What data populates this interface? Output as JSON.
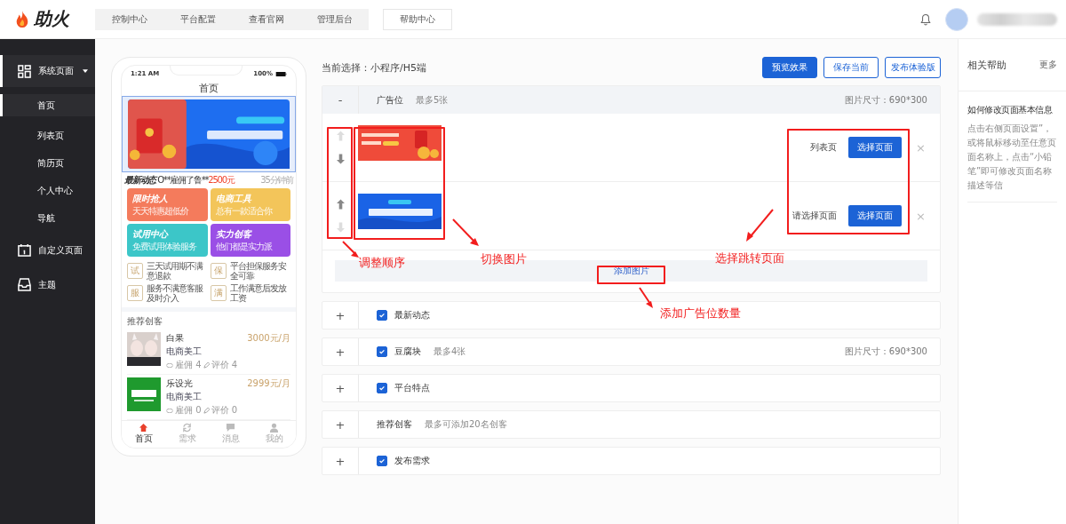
{
  "logo": {
    "text": "助火"
  },
  "top_nav": [
    {
      "label": "控制中心",
      "selected": false
    },
    {
      "label": "平台配置",
      "selected": false
    },
    {
      "label": "查看官网",
      "selected": false
    },
    {
      "label": "管理后台",
      "selected": false
    }
  ],
  "help_link": "帮助中心",
  "sidebar": {
    "items": [
      {
        "label": "系统页面",
        "expanded": true,
        "children": [
          {
            "label": "首页",
            "selected": true
          },
          {
            "label": "列表页",
            "selected": false
          },
          {
            "label": "简历页",
            "selected": false
          },
          {
            "label": "个人中心",
            "selected": false
          },
          {
            "label": "导航",
            "selected": false
          }
        ]
      },
      {
        "label": "自定义页面"
      },
      {
        "label": "主题"
      }
    ]
  },
  "phone": {
    "time": "1:21 AM",
    "battery": "100%",
    "title": "首页",
    "news": {
      "label": "最新动态",
      "text": "O**雇佣了鲁**",
      "amount": "2500元",
      "time": "35分钟前"
    },
    "tiles": [
      {
        "title": "限时抢人",
        "subtitle": "天天特惠超低价",
        "color": "#f47b5c"
      },
      {
        "title": "电商工具",
        "subtitle": "总有一款适合你",
        "color": "#f3c55a"
      },
      {
        "title": "试用中心",
        "subtitle": "免费试用体验服务",
        "color": "#3cc6c8"
      },
      {
        "title": "实力创客",
        "subtitle": "他们都是实力派",
        "color": "#9a4fe6"
      }
    ],
    "features": [
      {
        "badge": "试",
        "text": "三天试用期不满意退款"
      },
      {
        "badge": "保",
        "text": "平台担保服务安全可靠"
      },
      {
        "badge": "服",
        "text": "服务不满意客服及时介入"
      },
      {
        "badge": "满",
        "text": "工作满意后发放工资"
      }
    ],
    "creators_title": "推荐创客",
    "creators": [
      {
        "name": "白果",
        "price": "3000元/月",
        "role": "电商美工",
        "hires": "雇佣 4",
        "reviews": "评价 4"
      },
      {
        "name": "乐设光",
        "price": "2999元/月",
        "role": "电商美工",
        "hires": "雇佣 0",
        "reviews": "评价 0"
      }
    ],
    "tabbar": [
      {
        "label": "首页",
        "selected": true
      },
      {
        "label": "需求",
        "selected": false
      },
      {
        "label": "消息",
        "selected": false
      },
      {
        "label": "我的",
        "selected": false
      }
    ]
  },
  "editor": {
    "current": "当前选择：小程序/H5端",
    "actions": [
      {
        "label": "预览效果",
        "kind": "primary"
      },
      {
        "label": "保存当前",
        "kind": "outline"
      },
      {
        "label": "发布体验版",
        "kind": "outline"
      }
    ],
    "sections": [
      {
        "toggle": "-",
        "expanded": true,
        "kind": "plain",
        "title": "广告位",
        "note": "最多5张",
        "size": "图片尺寸：690*300",
        "slides": [
          {
            "up_enabled": false,
            "down_enabled": true,
            "link": "列表页",
            "button": "选择页面",
            "remove": "×"
          },
          {
            "up_enabled": true,
            "down_enabled": false,
            "link": "请选择页面",
            "button": "选择页面",
            "remove": "×"
          }
        ],
        "add_button": "添加图片"
      },
      {
        "toggle": "+",
        "expanded": false,
        "kind": "checkbox",
        "checked": true,
        "title": "最新动态"
      },
      {
        "toggle": "+",
        "expanded": false,
        "kind": "checkbox",
        "checked": true,
        "title": "豆腐块",
        "note": "最多4张",
        "size": "图片尺寸：690*300"
      },
      {
        "toggle": "+",
        "expanded": false,
        "kind": "checkbox",
        "checked": true,
        "title": "平台特点"
      },
      {
        "toggle": "+",
        "expanded": false,
        "kind": "plain",
        "title": "推荐创客",
        "note": "最多可添加20名创客"
      },
      {
        "toggle": "+",
        "expanded": false,
        "kind": "checkbox",
        "checked": true,
        "title": "发布需求"
      }
    ]
  },
  "annotations": [
    {
      "text": "调整顺序"
    },
    {
      "text": "切换图片"
    },
    {
      "text": "选择跳转页面"
    },
    {
      "text": "添加广告位数量"
    }
  ],
  "help": {
    "title": "相关帮助",
    "more": "更多",
    "articles": [
      {
        "title": "如何修改页面基本信息",
        "body": "点击右侧页面设置”，或将鼠标移动至任意页面名称上，点击“小铅笔”即可修改页面名称描述等信"
      }
    ]
  }
}
